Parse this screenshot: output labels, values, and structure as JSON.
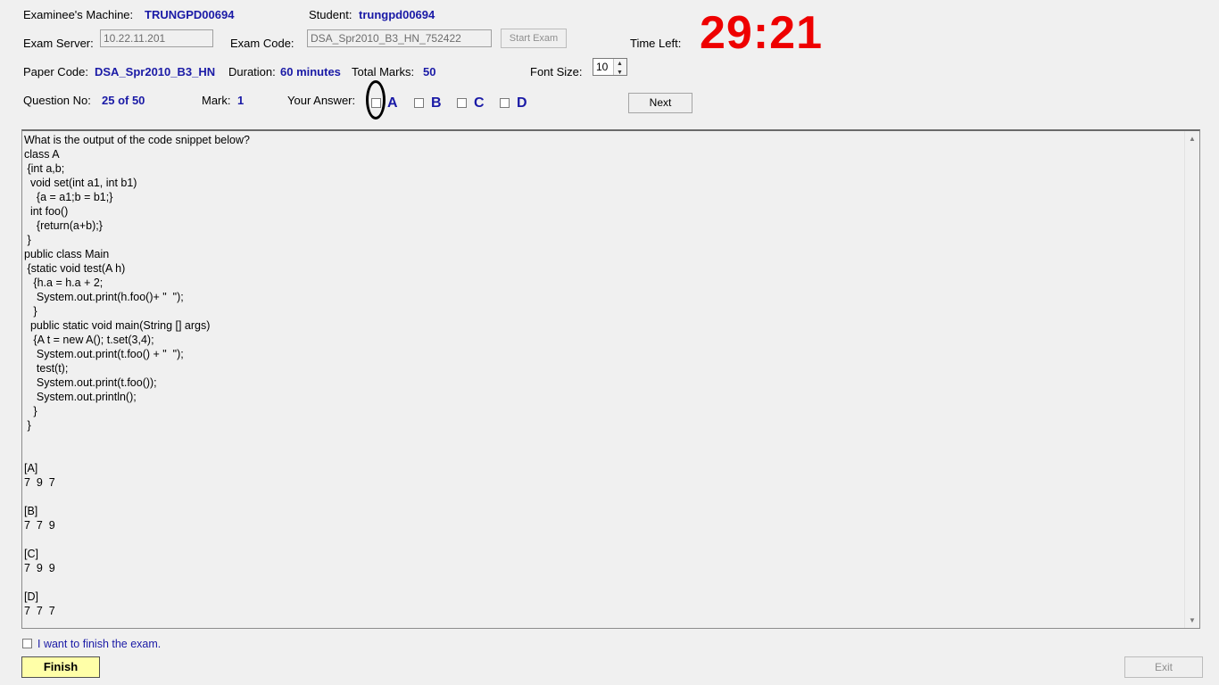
{
  "header": {
    "machine_label": "Examinee's Machine:",
    "machine_value": "TRUNGPD00694",
    "student_label": "Student:",
    "student_value": "trungpd00694",
    "server_label": "Exam Server:",
    "server_value": "10.22.11.201",
    "code_label": "Exam Code:",
    "code_value": "DSA_Spr2010_B3_HN_752422",
    "start_exam": "Start Exam",
    "time_left_label": "Time Left:",
    "time_left_value": "29:21",
    "paper_label": "Paper Code:",
    "paper_value": "DSA_Spr2010_B3_HN",
    "duration_label": "Duration:",
    "duration_value": "60 minutes",
    "total_label": "Total Marks:",
    "total_value": "50",
    "font_label": "Font Size:",
    "font_value": "10",
    "question_label": "Question No:",
    "question_value": "25 of 50",
    "mark_label": "Mark:",
    "mark_value": "1",
    "answer_label": "Your Answer:",
    "options": [
      "A",
      "B",
      "C",
      "D"
    ],
    "next": "Next"
  },
  "question": {
    "text": "What is the output of the code snippet below?\nclass A\n {int a,b;\n  void set(int a1, int b1)\n    {a = a1;b = b1;}\n  int foo()\n    {return(a+b);}\n }\npublic class Main\n {static void test(A h)\n   {h.a = h.a + 2;\n    System.out.print(h.foo()+ \"  \");\n   }\n  public static void main(String [] args)\n   {A t = new A(); t.set(3,4);\n    System.out.print(t.foo() + \"  \");\n    test(t);\n    System.out.print(t.foo());\n    System.out.println();\n   }\n }\n\n\n[A]\n7  9  7\n\n[B]\n7  7  9\n\n[C]\n7  9  9\n\n[D]\n7  7  7"
  },
  "footer": {
    "finish_check_label": "I want to finish the exam.",
    "finish": "Finish",
    "exit": "Exit"
  },
  "colors": {
    "value_blue": "#1a1aa6",
    "timer_red": "#ee0000",
    "finish_yellow": "#ffffa8"
  }
}
